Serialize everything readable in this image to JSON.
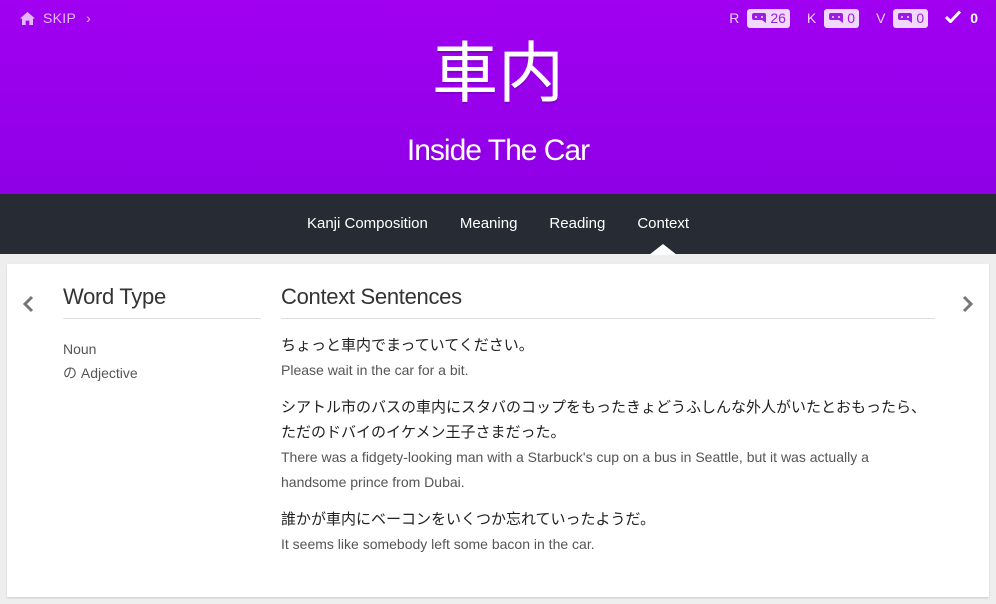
{
  "header": {
    "skip_label": "SKIP",
    "skip_chevron": "›",
    "kanji": "車内",
    "meaning": "Inside The Car",
    "stats": [
      {
        "letter": "R",
        "count": "26"
      },
      {
        "letter": "K",
        "count": "0"
      },
      {
        "letter": "V",
        "count": "0"
      }
    ],
    "check_count": "0"
  },
  "nav": {
    "tabs": [
      "Kanji Composition",
      "Meaning",
      "Reading",
      "Context"
    ],
    "active": "Context"
  },
  "word_type": {
    "title": "Word Type",
    "items": [
      "Noun",
      "の Adjective"
    ]
  },
  "context": {
    "title": "Context Sentences",
    "sentences": [
      {
        "ja": "ちょっと車内でまっていてください。",
        "en": "Please wait in the car for a bit."
      },
      {
        "ja": "シアトル市のバスの車内にスタバのコップをもったきょどうふしんな外人がいたとおもったら、ただのドバイのイケメン王子さまだった。",
        "en": "There was a fidgety-looking man with a Starbuck's cup on a bus in Seattle, but it was actually a handsome prince from Dubai."
      },
      {
        "ja": "誰かが車内にベーコンをいくつか忘れていったようだ。",
        "en": "It seems like somebody left some bacon in the car."
      }
    ]
  },
  "colors": {
    "header_purple": "#9b00ed",
    "nav_dark": "#272b33",
    "badge_text": "#9b1de6"
  },
  "icons": [
    "home-icon",
    "chevron-right-icon",
    "reviews-icon",
    "check-icon",
    "arrow-left-icon",
    "arrow-right-icon"
  ]
}
